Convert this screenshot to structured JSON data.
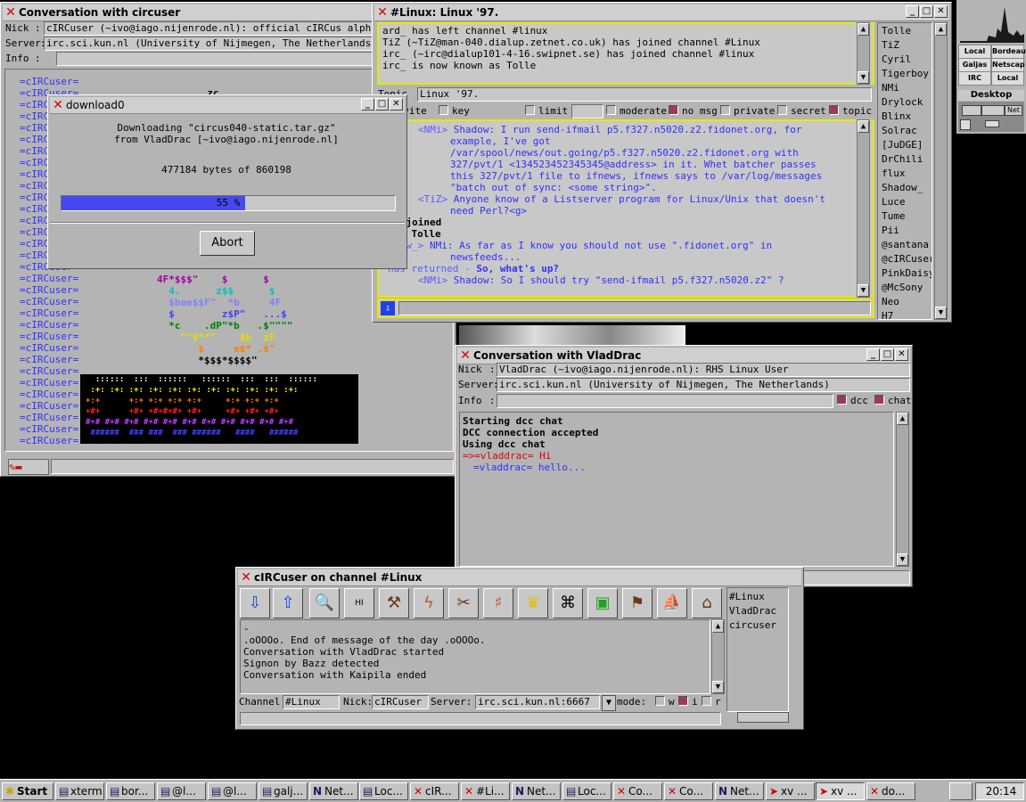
{
  "win_main": {
    "title": "Conversation with circuser",
    "nick_label": "Nick",
    "nick_value": "cIRCuser (~ivo@iago.nijenrode.nl): official cIRCus alpha-test",
    "server_label": "Server",
    "server_value": "irc.sci.kun.nl (University of Nijmegen, The Netherlands)",
    "info_label": "Info",
    "prefix": "=cIRCuser="
  },
  "win_download": {
    "title": "download0",
    "line1": "Downloading \"circus040-static.tar.gz\"",
    "line2": "from VladDrac [~ivo@iago.nijenrode.nl]",
    "bytes": "477184 bytes of 860198",
    "progress": 0.55,
    "progress_label": "55 %",
    "abort": "Abort"
  },
  "win_linux": {
    "title": "#Linux: Linux '97.",
    "topic_label": "Topic",
    "topic_value": "Linux '97.",
    "top_lines": [
      "ard_ has left channel #linux",
      "TiZ (~TiZ@man-040.dialup.zetnet.co.uk) has joined channel #Linux",
      "irc_ (~irc@dialup101-4-16.swipnet.se) has joined channel #linux",
      "irc_ is now known as Tolle"
    ],
    "modes": {
      "invite": "invite",
      "key": "key",
      "limit": "limit",
      "moderate": "moderate",
      "nomsg": "no msg",
      "private": "private",
      "secret": "secret",
      "topic": "topic"
    },
    "users": [
      "Tolle",
      "TiZ",
      "Cyril",
      "Tigerboy",
      "NMi",
      "Drylock",
      "Blinx",
      "Solrac",
      "[JuDGE]",
      "DrChili",
      "flux",
      "Shadow_",
      "Luce",
      "Tume",
      "Pii",
      "@santana",
      "@cIRCuser",
      "PinkDaisy",
      "@McSony",
      "Neo",
      "H7"
    ],
    "msg": {
      "l1n": "<NMi>",
      "l1": "Shadow: I run send-ifmail p5.f327.n5020.z2.fidonet.org, for",
      "l2": "example, I've got",
      "l3": "/var/spool/news/out.going/p5.f327.n5020.z2.fidonet.org with",
      "l4": "327/pvt/1 <134523452345345@address> in it. Whet batcher passes",
      "l5": "this 327/pvt/1 file to ifnews, ifnews says to /var/log/messages",
      "l6": "\"batch out of sync: <some string>\".",
      "l7n": "<TiZ>",
      "l7": "Anyone know of a Listserver program for Linux/Unix that doesn't",
      "l8": "need Perl?<g>",
      "l9": "has joined",
      "l10": "--> Tolle",
      "l11n": "hadow_>",
      "l11": "NMi: As far as I know you should not use \".fidonet.org\" in",
      "l12": "newsfeeds...",
      "l13a": "has returned - ",
      "l13b": "So, what's up?",
      "l14n": "<NMi>",
      "l14": "Shadow: So I should try \"send-ifmail p5.f327.n5020.z2\" ?"
    }
  },
  "win_vlad": {
    "title": "Conversation with VladDrac",
    "nick_label": "Nick",
    "nick_value": "VladDrac (~ivo@iago.nijenrode.nl): RHS Linux User",
    "server_label": "Server",
    "server_value": "irc.sci.kun.nl (University of Nijmegen, The Netherlands)",
    "info_label": "Info",
    "dcc": "dcc",
    "chat": "chat",
    "lines": [
      "Starting dcc chat",
      "DCC connection accepted",
      "Using dcc chat"
    ],
    "hi_prefix": "=>=vladdrac=",
    "hi": "Hi",
    "hello_prefix": "=vladdrac=",
    "hello": "hello..."
  },
  "win_channel": {
    "title": "cIRCuser on channel #Linux",
    "lines": [
      "-",
      ".oOOOo. End of message of the day .oOOOo.",
      "Conversation with VladDrac started",
      "Signon by Bazz detected",
      "Conversation with Kaipila ended"
    ],
    "list": [
      "#Linux",
      "VladDrac",
      "circuser"
    ],
    "channel_label": "Channel:",
    "channel_value": "#Linux",
    "nick_label": "Nick:",
    "nick_value": "cIRCuser",
    "server_label": "Server:",
    "server_value": "irc.sci.kun.nl:6667",
    "mode_label": "mode:",
    "mode_w": "w",
    "mode_i": "i",
    "mode_r": "r"
  },
  "pager": {
    "cells": [
      "Local",
      "Bordeau",
      "Galjas",
      "Netscap",
      "IRC",
      "Local"
    ],
    "desktop": "Desktop",
    "net": "Net"
  },
  "taskbar": {
    "start": "Start",
    "clock": "20:14",
    "items": [
      "xterm",
      "bor...",
      "@l...",
      "@l...",
      "galj...",
      "Net...",
      "Loc...",
      "cIR...",
      "#Li...",
      "Net...",
      "Loc...",
      "Co...",
      "Co...",
      "Net...",
      "xv ...",
      "xv ...",
      "do..."
    ]
  }
}
